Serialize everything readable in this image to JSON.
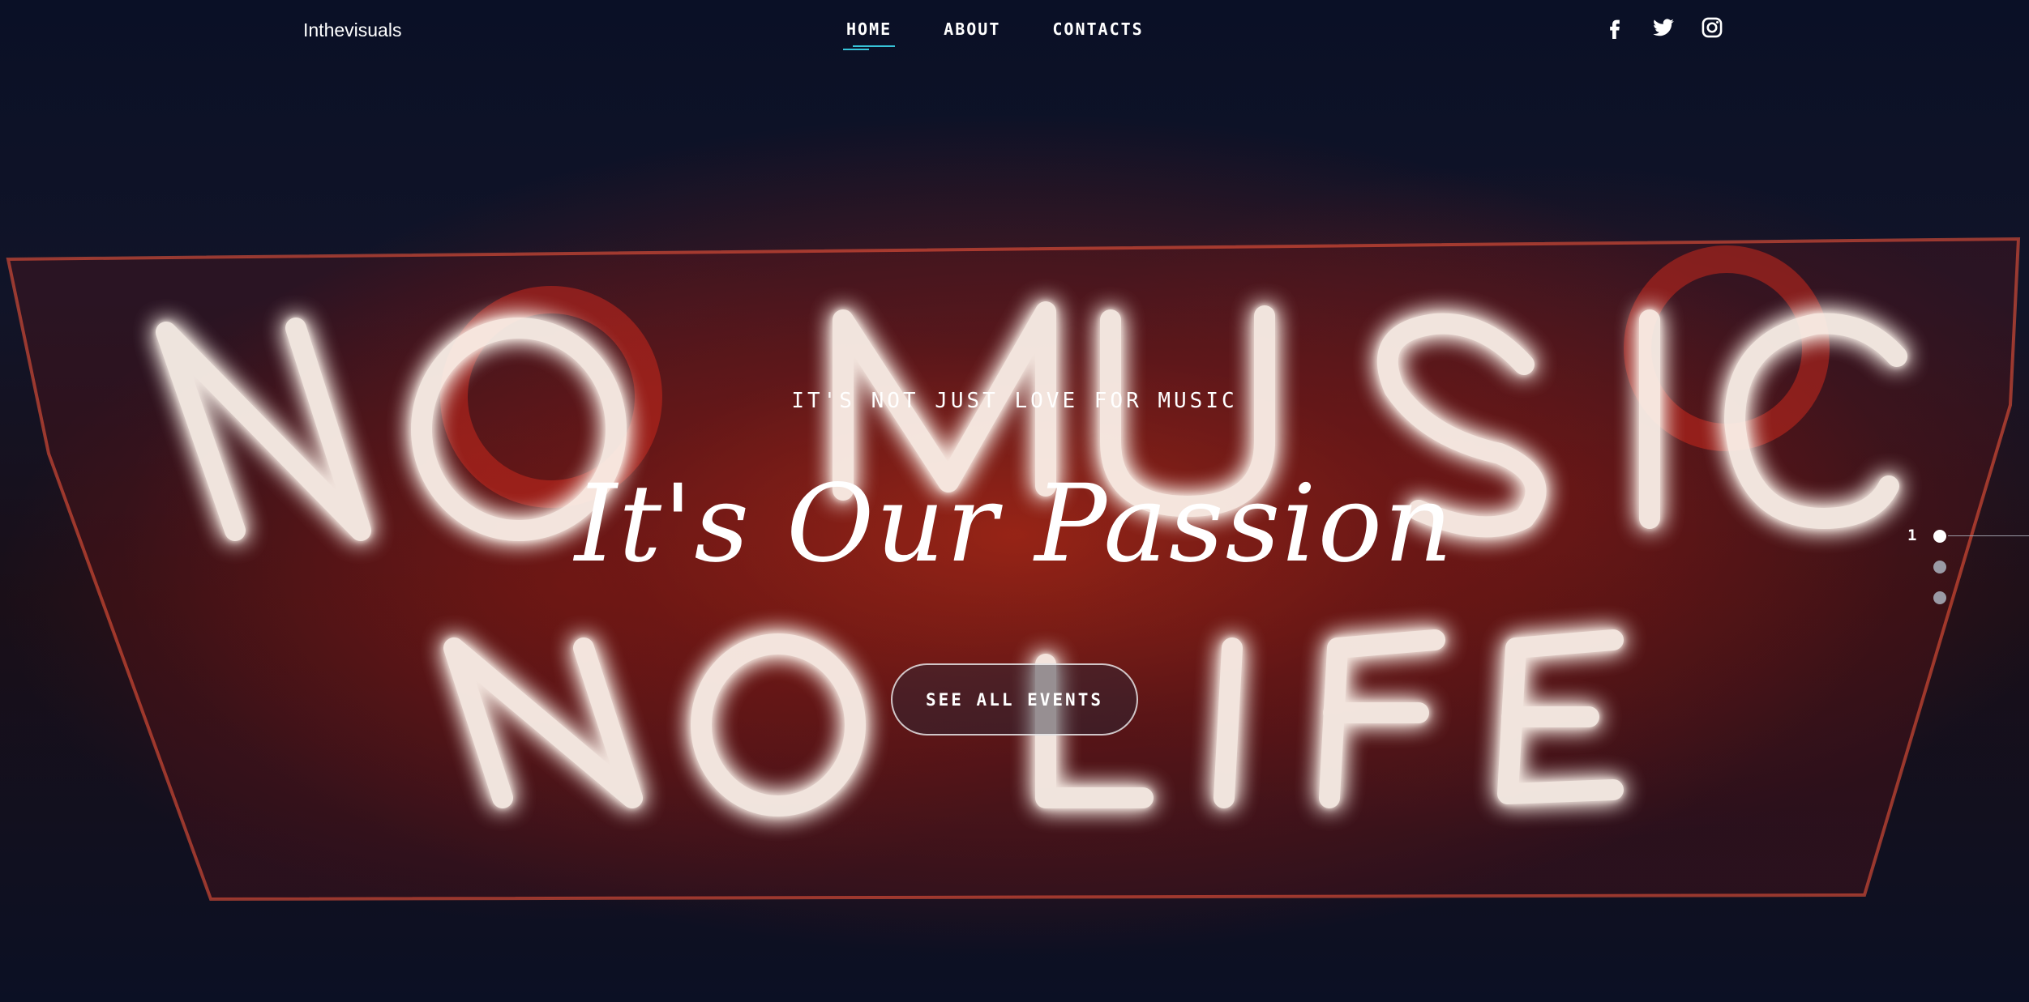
{
  "header": {
    "brand": "Inthevisuals",
    "nav": [
      {
        "label": "HOME",
        "active": true
      },
      {
        "label": "ABOUT",
        "active": false
      },
      {
        "label": "CONTACTS",
        "active": false
      }
    ],
    "social_icons": [
      "facebook-icon",
      "twitter-icon",
      "instagram-icon"
    ],
    "accent_color": "#37c3d8"
  },
  "hero": {
    "eyebrow": "IT'S NOT JUST LOVE FOR MUSIC",
    "headline": "It's Our Passion",
    "cta_label": "SEE ALL EVENTS",
    "background_sign": [
      "NO MUSIC",
      "NO LIFE"
    ]
  },
  "pager": {
    "current": "1",
    "total_dots": 3,
    "active_index": 0
  }
}
